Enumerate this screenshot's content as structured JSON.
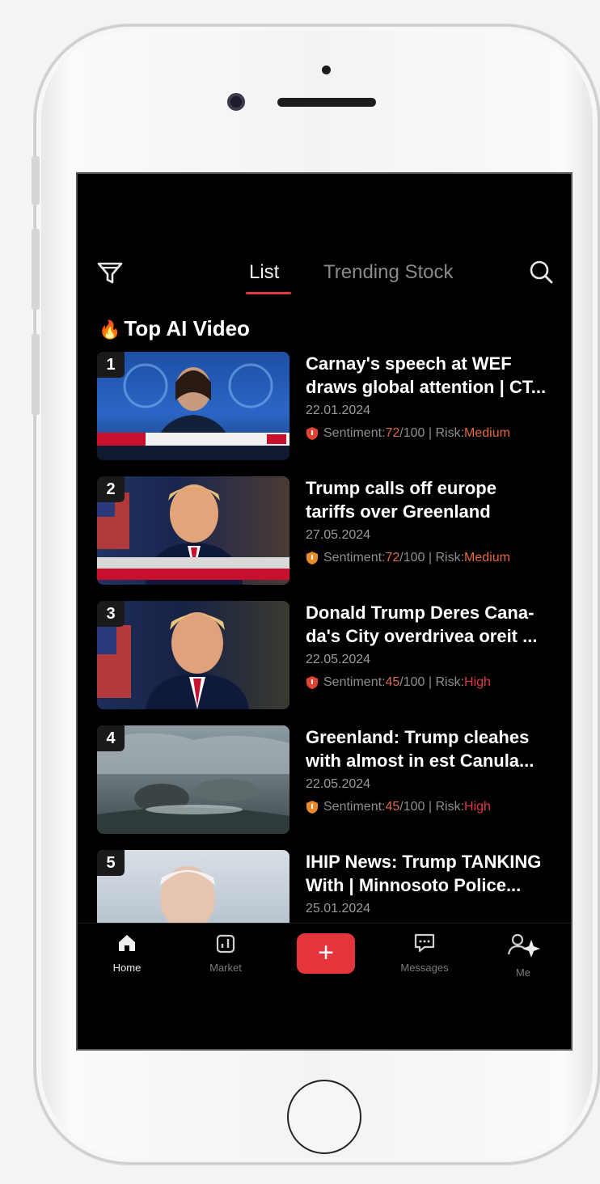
{
  "nav": {
    "tabs": [
      {
        "label": "List",
        "active": true
      },
      {
        "label": "Trending Stock",
        "active": false
      }
    ],
    "filter_icon": "funnel-icon",
    "search_icon": "search-icon"
  },
  "section": {
    "title": "Top AI Video",
    "icon": "fire-icon"
  },
  "items": [
    {
      "rank": "1",
      "title_l1": "Carnay's speech at WEF",
      "title_l2": "draws global attention | CT...",
      "date": "22.01.2024",
      "sentiment_label": "Sentiment: ",
      "score": "72",
      "score_max": "/100 | Risk: ",
      "risk": "Medium"
    },
    {
      "rank": "2",
      "title_l1": "Trump calls off europe",
      "title_l2": "tariffs over Greenland",
      "date": "27.05.2024",
      "sentiment_label": "Sentiment: ",
      "score": "72",
      "score_max": "/100 | Risk: ",
      "risk": "Medium"
    },
    {
      "rank": "3",
      "title_l1": "Donald Trump Deres Cana-",
      "title_l2": "da's City overdrivea oreit ...",
      "date": "22.05.2024",
      "sentiment_label": "Sentiment: ",
      "score": "45",
      "score_max": "/100 | Risk: ",
      "risk": "High"
    },
    {
      "rank": "4",
      "title_l1": "Greenland: Trump cleahes",
      "title_l2": "with almost in est Canula...",
      "date": "22.05.2024",
      "sentiment_label": "Sentiment: ",
      "score": "45",
      "score_max": "/100 | Risk: ",
      "risk": "High"
    },
    {
      "rank": "5",
      "title_l1": "IHIP News: Trump TANKING",
      "title_l2": "With | Minnosoto Police...",
      "date": "25.01.2024"
    }
  ],
  "bottom_nav": [
    {
      "label": "Home",
      "icon": "home-icon",
      "active": true
    },
    {
      "label": "Market",
      "icon": "chart-icon",
      "active": false
    },
    {
      "label": "",
      "icon": "plus-icon",
      "active": false
    },
    {
      "label": "Messages",
      "icon": "message-icon",
      "active": false
    },
    {
      "label": "Me",
      "icon": "user-sparkle-icon",
      "active": false
    }
  ],
  "colors": {
    "accent": "#e4353d",
    "risk_medium": "#e3683a",
    "risk_high": "#e0394a",
    "score": "#d8684e"
  }
}
